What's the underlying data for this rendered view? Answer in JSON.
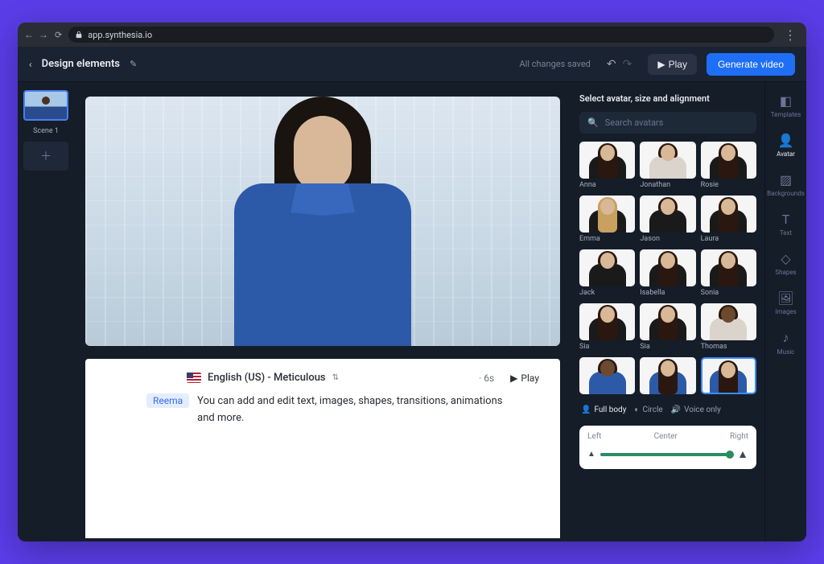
{
  "browser": {
    "url": "app.synthesia.io"
  },
  "header": {
    "title": "Design elements",
    "save_status": "All changes saved",
    "play_label": "Play",
    "generate_label": "Generate video"
  },
  "scenes": {
    "scene1_label": "Scene 1"
  },
  "script": {
    "language_label": "English (US) - Meticulous",
    "duration": "· 6s",
    "play_label": "Play",
    "speaker": "Reema",
    "text": "You can add and edit text, images, shapes, transitions, animations and more."
  },
  "avatar_panel": {
    "title": "Select avatar, size and alignment",
    "search_placeholder": "Search avatars",
    "avatars": [
      "Anna",
      "Jonathan",
      "Rosie",
      "Emma",
      "Jason",
      "Laura",
      "Jack",
      "Isabella",
      "Sonia",
      "Sia",
      "Sia",
      "Thomas"
    ],
    "view_modes": {
      "full_body": "Full body",
      "circle": "Circle",
      "voice_only": "Voice only"
    },
    "align": {
      "left": "Left",
      "center": "Center",
      "right": "Right"
    }
  },
  "tools": {
    "templates": "Templates",
    "avatar": "Avatar",
    "backgrounds": "Backgrounds",
    "text": "Text",
    "shapes": "Shapes",
    "images": "Images",
    "music": "Music"
  }
}
